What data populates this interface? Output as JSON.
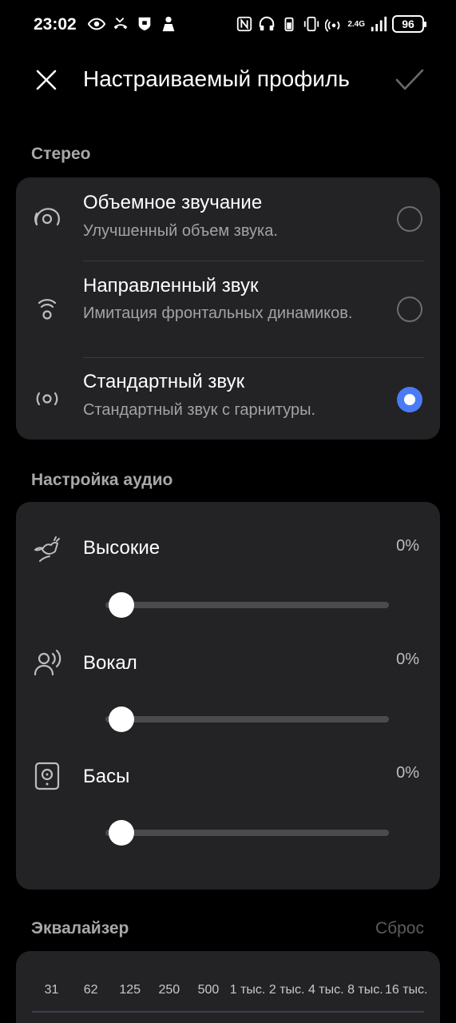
{
  "status": {
    "time": "23:02",
    "battery": "96",
    "network": "2.4G"
  },
  "app_bar": {
    "title": "Настраиваемый профиль",
    "close_icon": "close-icon",
    "confirm_icon": "check-icon"
  },
  "stereo": {
    "section_title": "Стерео",
    "options": [
      {
        "title": "Объемное звучание",
        "subtitle": "Улучшенный объем звука.",
        "icon": "surround-sound-icon",
        "selected": false
      },
      {
        "title": "Направленный звук",
        "subtitle": "Имитация фронтальных динамиков.",
        "icon": "directional-sound-icon",
        "selected": false
      },
      {
        "title": "Стандартный звук",
        "subtitle": "Стандартный звук с гарнитуры.",
        "icon": "standard-sound-icon",
        "selected": true
      }
    ]
  },
  "audio": {
    "section_title": "Настройка аудио",
    "sliders": [
      {
        "label": "Высокие",
        "value": "0%",
        "level": 0,
        "icon": "bird-icon"
      },
      {
        "label": "Вокал",
        "value": "0%",
        "level": 0,
        "icon": "voice-icon"
      },
      {
        "label": "Басы",
        "value": "0%",
        "level": 0,
        "icon": "speaker-icon"
      }
    ]
  },
  "equalizer": {
    "section_title": "Эквалайзер",
    "reset_label": "Сброс",
    "frequencies": [
      "31",
      "62",
      "125",
      "250",
      "500",
      "1 тыс.",
      "2 тыс.",
      "4 тыс.",
      "8 тыс.",
      "16 тыс."
    ]
  },
  "colors": {
    "background": "#000000",
    "card": "#232325",
    "accent": "#4a7bf7",
    "section_title": "#a8a8a8"
  }
}
